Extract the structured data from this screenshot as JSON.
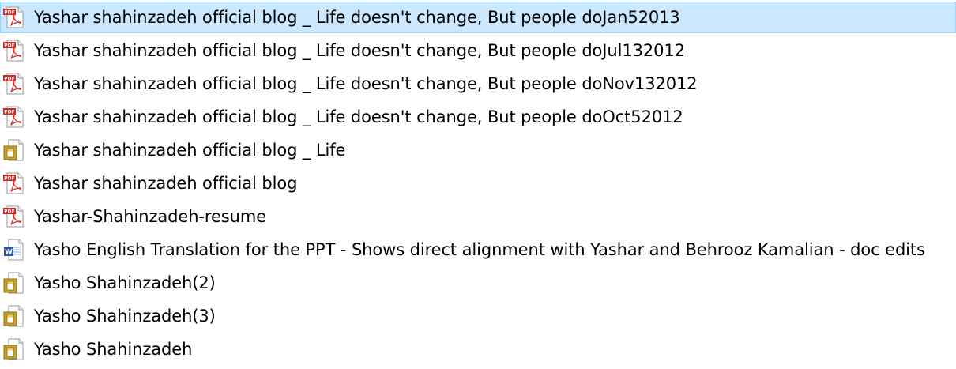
{
  "files": [
    {
      "name": "Yashar shahinzadeh official blog _ Life doesn't change, But people doJan52013",
      "icon": "pdf-icon",
      "selected": true
    },
    {
      "name": "Yashar shahinzadeh official blog _ Life doesn't change, But people doJul132012",
      "icon": "pdf-icon",
      "selected": false
    },
    {
      "name": "Yashar shahinzadeh official blog _ Life doesn't change, But people doNov132012",
      "icon": "pdf-icon",
      "selected": false
    },
    {
      "name": "Yashar shahinzadeh official blog _ Life doesn't change, But people doOct52012",
      "icon": "pdf-icon",
      "selected": false
    },
    {
      "name": "Yashar shahinzadeh official blog _ Life",
      "icon": "generic-file-icon",
      "selected": false
    },
    {
      "name": "Yashar shahinzadeh official blog",
      "icon": "pdf-icon",
      "selected": false
    },
    {
      "name": "Yashar-Shahinzadeh-resume",
      "icon": "pdf-icon",
      "selected": false
    },
    {
      "name": "Yasho English Translation for the PPT - Shows direct alignment with Yashar and Behrooz Kamalian - doc edits",
      "icon": "word-doc-icon",
      "selected": false
    },
    {
      "name": "Yasho Shahinzadeh(2)",
      "icon": "generic-file-icon",
      "selected": false
    },
    {
      "name": "Yasho Shahinzadeh(3)",
      "icon": "generic-file-icon",
      "selected": false
    },
    {
      "name": "Yasho Shahinzadeh",
      "icon": "generic-file-icon",
      "selected": false
    }
  ],
  "colors": {
    "selection_bg": "#cce8ff",
    "selection_border": "#99d1ff",
    "pdf_red": "#d3261f",
    "word_blue": "#2b579a",
    "generic_gold": "#c9a227"
  }
}
